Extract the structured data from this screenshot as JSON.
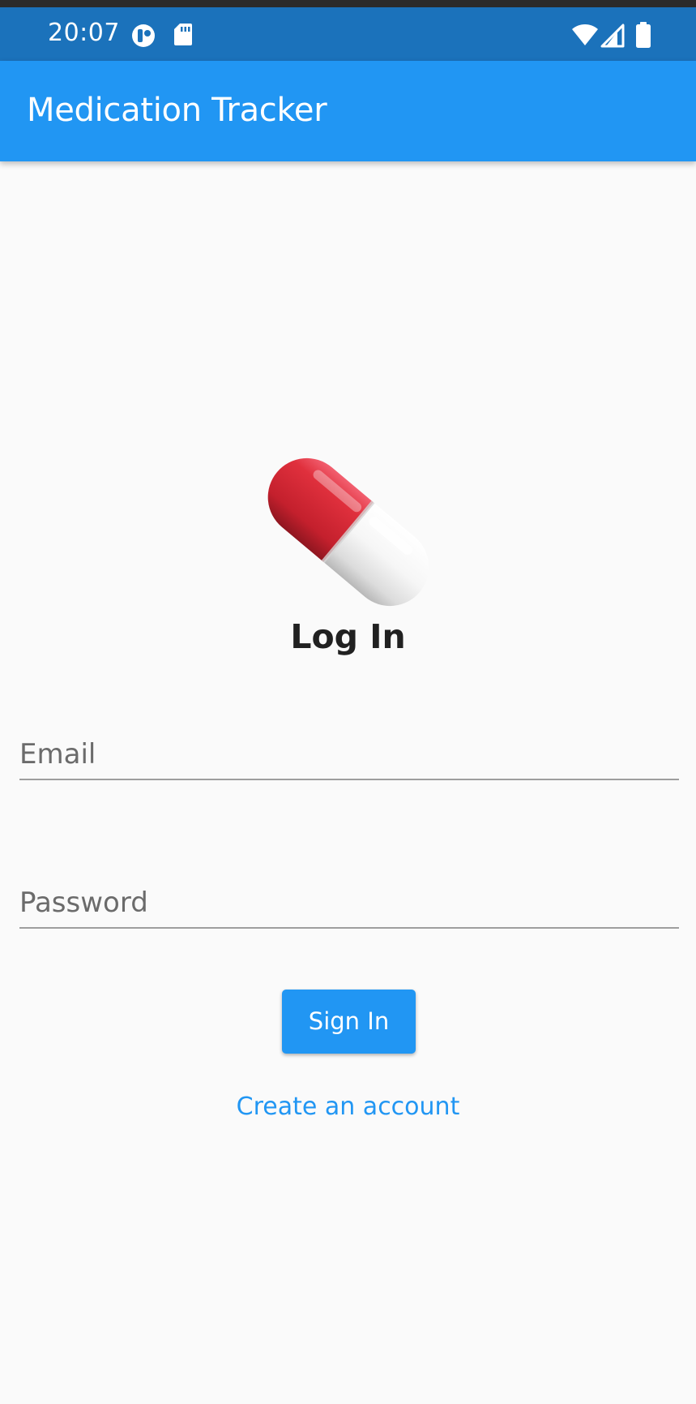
{
  "status_bar": {
    "time": "20:07",
    "left_icons": [
      "app-notification-icon",
      "sd-card-icon"
    ],
    "right_icons": [
      "wifi-icon",
      "cellular-signal-icon",
      "battery-icon"
    ]
  },
  "app_bar": {
    "title": "Medication Tracker",
    "color": "#2196f3"
  },
  "login": {
    "logo_icon": "pill-capsule-icon",
    "heading": "Log In",
    "email": {
      "placeholder": "Email",
      "value": ""
    },
    "password": {
      "placeholder": "Password",
      "value": ""
    },
    "sign_in_label": "Sign In",
    "create_account_label": "Create an account"
  },
  "colors": {
    "accent": "#2196f3",
    "status_bar": "#1b72bb",
    "background": "#fafafa"
  }
}
